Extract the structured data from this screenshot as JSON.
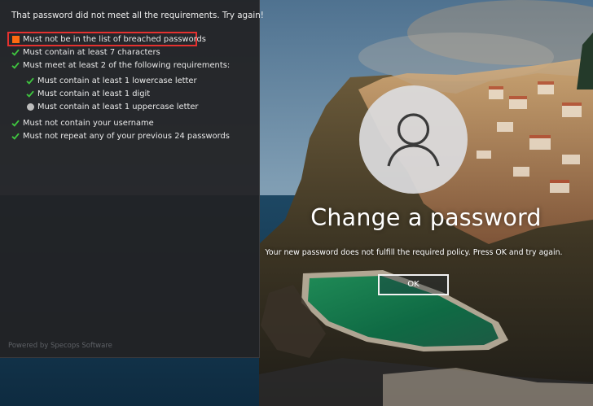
{
  "requirements_panel": {
    "header": "That password did not meet all the requirements. Try again!",
    "items": [
      {
        "status": "failed",
        "label": "Must not be in the list of breached passwords"
      },
      {
        "status": "passed",
        "label": "Must contain at least 7 characters"
      },
      {
        "status": "passed",
        "label": "Must meet at least 2 of the following requirements:"
      },
      {
        "status": "passed",
        "label": "Must contain at least 1 lowercase letter"
      },
      {
        "status": "passed",
        "label": "Must contain at least 1 digit"
      },
      {
        "status": "neutral",
        "label": "Must contain at least 1 uppercase letter"
      },
      {
        "status": "passed",
        "label": "Must not contain your username"
      },
      {
        "status": "passed",
        "label": "Must not repeat any of your previous 24 passwords"
      }
    ],
    "footer": "Powered by Specops Software"
  },
  "dialog": {
    "avatar_icon": "user-icon",
    "title": "Change a password",
    "message": "Your new password does not fulfill the required policy. Press OK and try again.",
    "ok_label": "OK"
  },
  "colors": {
    "panel_bg": "#222224",
    "check_green": "#3fc43f",
    "failed_orange": "#ff6a10",
    "highlight_red": "#e5312f",
    "neutral_gray": "#bdbdbd"
  }
}
